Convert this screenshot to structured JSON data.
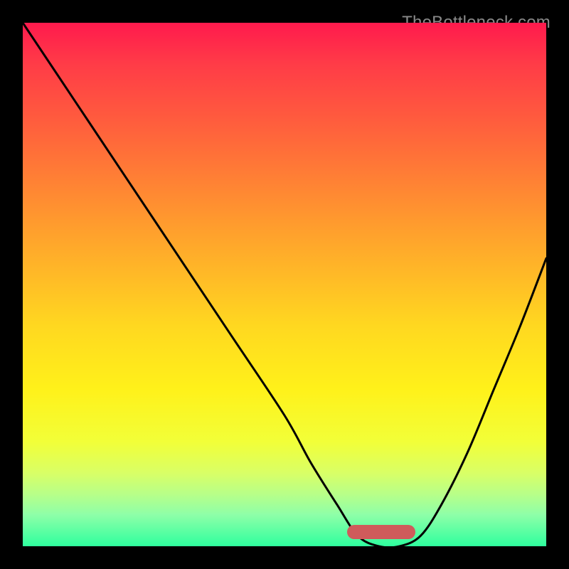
{
  "watermark": {
    "text": "TheBottleneck.com"
  },
  "colors": {
    "background": "#000000",
    "curve": "#000000",
    "trough": "#cf5b5b",
    "watermark": "#8a8a8a"
  },
  "chart_data": {
    "type": "line",
    "title": "",
    "xlabel": "",
    "ylabel": "",
    "xlim": [
      0,
      100
    ],
    "ylim": [
      0,
      100
    ],
    "grid": false,
    "legend": false,
    "series": [
      {
        "name": "bottleneck-curve",
        "x": [
          0,
          10,
          20,
          30,
          40,
          50,
          55,
          60,
          64,
          68,
          72,
          76,
          80,
          85,
          90,
          95,
          100
        ],
        "values": [
          100,
          85,
          70,
          55,
          40,
          25,
          16,
          8,
          2,
          0,
          0,
          2,
          8,
          18,
          30,
          42,
          55
        ]
      }
    ],
    "trough_range_x": [
      62,
      75
    ],
    "gradient_stops": [
      {
        "pct": 0,
        "color": "#ff1a4d"
      },
      {
        "pct": 8,
        "color": "#ff3c47"
      },
      {
        "pct": 18,
        "color": "#ff5a3e"
      },
      {
        "pct": 28,
        "color": "#ff7a36"
      },
      {
        "pct": 38,
        "color": "#ff9a2e"
      },
      {
        "pct": 48,
        "color": "#ffb927"
      },
      {
        "pct": 58,
        "color": "#ffd820"
      },
      {
        "pct": 70,
        "color": "#fff11a"
      },
      {
        "pct": 80,
        "color": "#f2ff38"
      },
      {
        "pct": 86,
        "color": "#d9ff66"
      },
      {
        "pct": 90,
        "color": "#b8ff88"
      },
      {
        "pct": 94,
        "color": "#8effa8"
      },
      {
        "pct": 100,
        "color": "#2eff9e"
      }
    ]
  }
}
